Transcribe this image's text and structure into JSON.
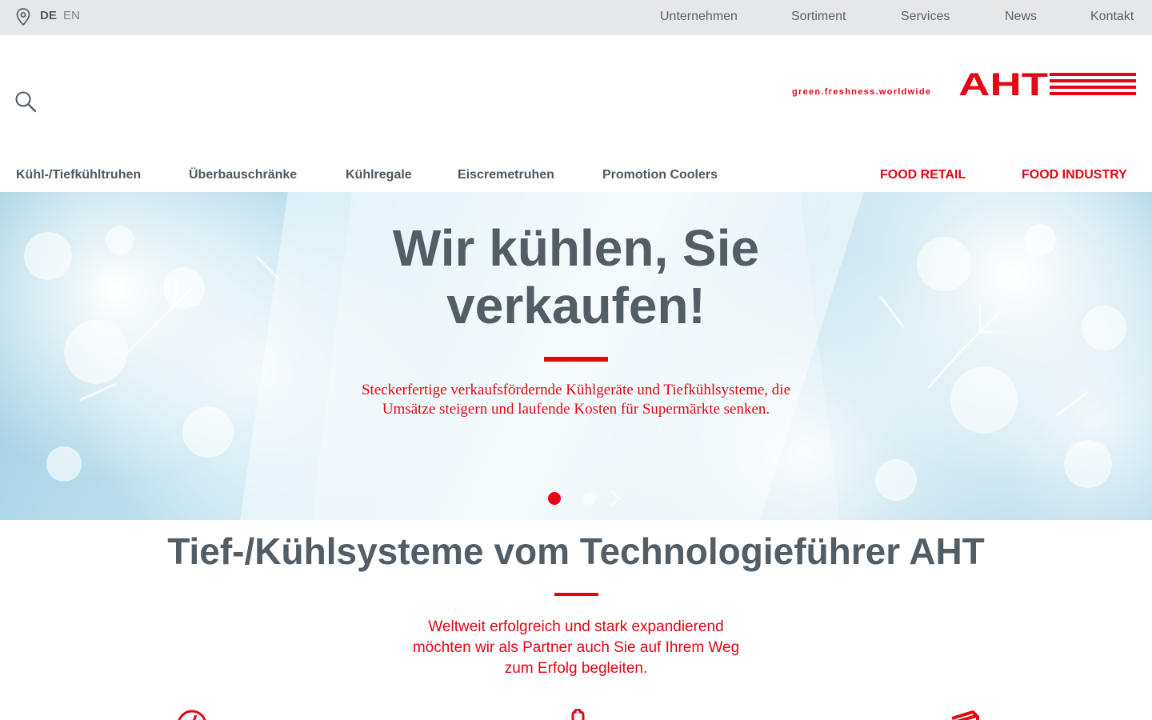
{
  "topbar": {
    "languages": {
      "de": "DE",
      "en": "EN"
    },
    "nav": [
      "Unternehmen",
      "Sortiment",
      "Services",
      "News",
      "Kontakt"
    ]
  },
  "header": {
    "slogan": "green.freshness.worldwide",
    "logo_text": "AHT",
    "brand_color": "#e30613"
  },
  "mainnav": {
    "items": [
      "Kühl-/Tiefkühltruhen",
      "Überbauschränke",
      "Kühlregale",
      "Eiscremetruhen",
      "Promotion Coolers"
    ],
    "segments": [
      "FOOD RETAIL",
      "FOOD INDUSTRY"
    ]
  },
  "hero": {
    "title_line1": "Wir kühlen, Sie",
    "title_line2": "verkaufen!",
    "text_line1": "Steckerfertige verkaufsfördernde Kühlgeräte und Tiefkühlsysteme, die",
    "text_line2": "Umsätze steigern und laufende Kosten für Supermärkte senken."
  },
  "intro": {
    "title": "Tief-/Kühlsysteme vom Technologieführer AHT",
    "text_line1": "Weltweit erfolgreich und stark expandierend",
    "text_line2": "möchten wir als Partner auch Sie auf Ihrem Weg",
    "text_line3": "zum Erfolg begleiten."
  }
}
